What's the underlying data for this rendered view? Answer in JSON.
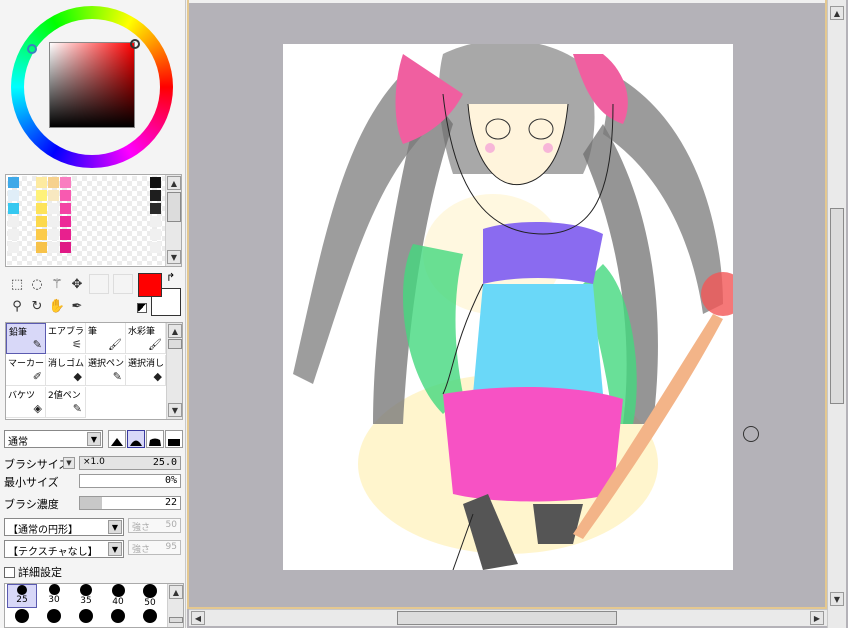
{
  "colors": {
    "foreground": "#ff0000",
    "background": "#ffffff",
    "canvas_bg": "#b4b2b8",
    "selection": "#d8d8f8"
  },
  "palette_columns": [
    [
      "#3fa9e8",
      "#e0eef8",
      "#36c8f0",
      "#f0f0f0",
      "#f0f0f0",
      "#f0f0f0"
    ],
    [
      "#fdeaa0",
      "#fff27a",
      "#fde35a",
      "#fcd94c",
      "#fccb4a",
      "#f7c24a"
    ],
    [
      "#f6d18e",
      "#f8e8c0",
      "#f0f0f0",
      "#f0f0f0",
      "#f0f0f0",
      "#f0f0f0"
    ],
    [
      "#f97ec0",
      "#f85ab0",
      "#f342a4",
      "#ed2a98",
      "#e8208e",
      "#e01a86"
    ],
    [
      "#111111",
      "#1e1e1e",
      "#2a2a2a",
      "#f0f0f0",
      "#f0f0f0",
      "#f0f0f0"
    ]
  ],
  "tool_icons": [
    "rect-select-icon",
    "lasso-icon",
    "magic-wand-icon",
    "move-icon",
    "zoom-icon",
    "rotate-icon",
    "hand-icon",
    "eyedropper-icon"
  ],
  "brushes": [
    {
      "label": "鉛筆",
      "icon": "pencil-icon",
      "glyph": "✎"
    },
    {
      "label": "エアブラシ",
      "icon": "airbrush-icon",
      "glyph": "⚟"
    },
    {
      "label": "筆",
      "icon": "brush-icon",
      "glyph": "🖌"
    },
    {
      "label": "水彩筆",
      "icon": "watercolor-icon",
      "glyph": "🖌"
    },
    {
      "label": "マーカー",
      "icon": "marker-icon",
      "glyph": "✐"
    },
    {
      "label": "消しゴム",
      "icon": "eraser-icon",
      "glyph": "◆"
    },
    {
      "label": "選択ペン",
      "icon": "select-pen-icon",
      "glyph": "✎"
    },
    {
      "label": "選択消し",
      "icon": "select-erase-icon",
      "glyph": "◆"
    },
    {
      "label": "バケツ",
      "icon": "bucket-icon",
      "glyph": "◈"
    },
    {
      "label": "2値ペン",
      "icon": "binary-pen-icon",
      "glyph": "✎"
    }
  ],
  "blend_mode": "通常",
  "brush_size": {
    "label": "ブラシサイズ",
    "multiplier": "×1.0",
    "value": "25.0"
  },
  "min_size": {
    "label": "最小サイズ",
    "value": "0%"
  },
  "density": {
    "label": "ブラシ濃度",
    "value": "22"
  },
  "shape": {
    "value": "【通常の円形】",
    "strength_label": "強さ",
    "strength": "50"
  },
  "texture": {
    "value": "【テクスチャなし】",
    "strength_label": "強さ",
    "strength": "95"
  },
  "detail_label": "詳細設定",
  "brush_sizes": [
    "25",
    "30",
    "35",
    "40",
    "50"
  ]
}
